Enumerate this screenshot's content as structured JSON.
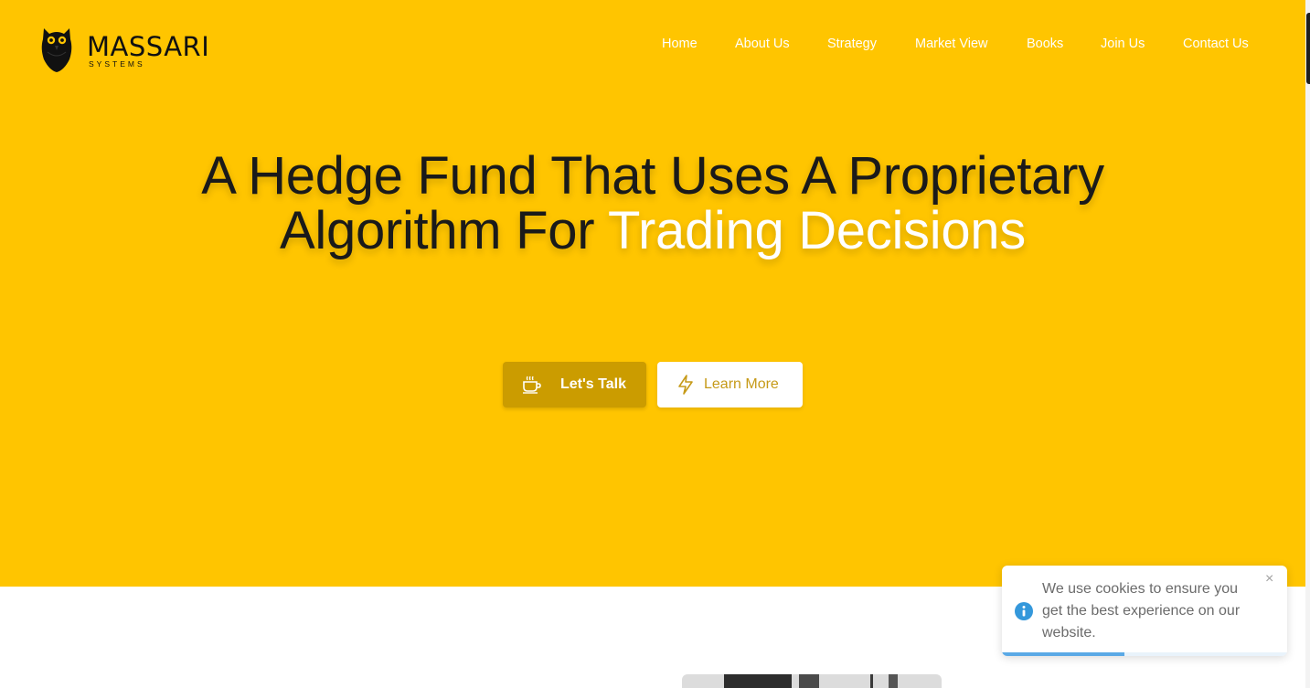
{
  "brand": {
    "name": "MASSARI",
    "tagline": "SYSTEMS"
  },
  "nav": {
    "items": [
      {
        "label": "Home"
      },
      {
        "label": "About Us"
      },
      {
        "label": "Strategy"
      },
      {
        "label": "Market View"
      },
      {
        "label": "Books"
      },
      {
        "label": "Join Us"
      },
      {
        "label": "Contact Us"
      }
    ]
  },
  "hero": {
    "headline_line1": "A Hedge Fund That Uses A Proprietary",
    "headline_line2_prefix": "Algorithm For ",
    "headline_highlight": "Trading Decisions",
    "primary_button": {
      "label": "Let's Talk",
      "icon": "coffee-cup-icon"
    },
    "secondary_button": {
      "label": "Learn More",
      "icon": "lightning-bolt-icon"
    }
  },
  "cookie_notice": {
    "message": "We use cookies to ensure you get the best experience on our website.",
    "close_symbol": "×",
    "icon": "info-icon",
    "progress": 0.43
  },
  "colors": {
    "hero_background": "#ffc500",
    "primary_button": "#cb9c00",
    "secondary_button_text": "#c69a18",
    "headline_text": "#1a1a1a",
    "headline_highlight": "#ffffff",
    "info_blue": "#3498db"
  }
}
